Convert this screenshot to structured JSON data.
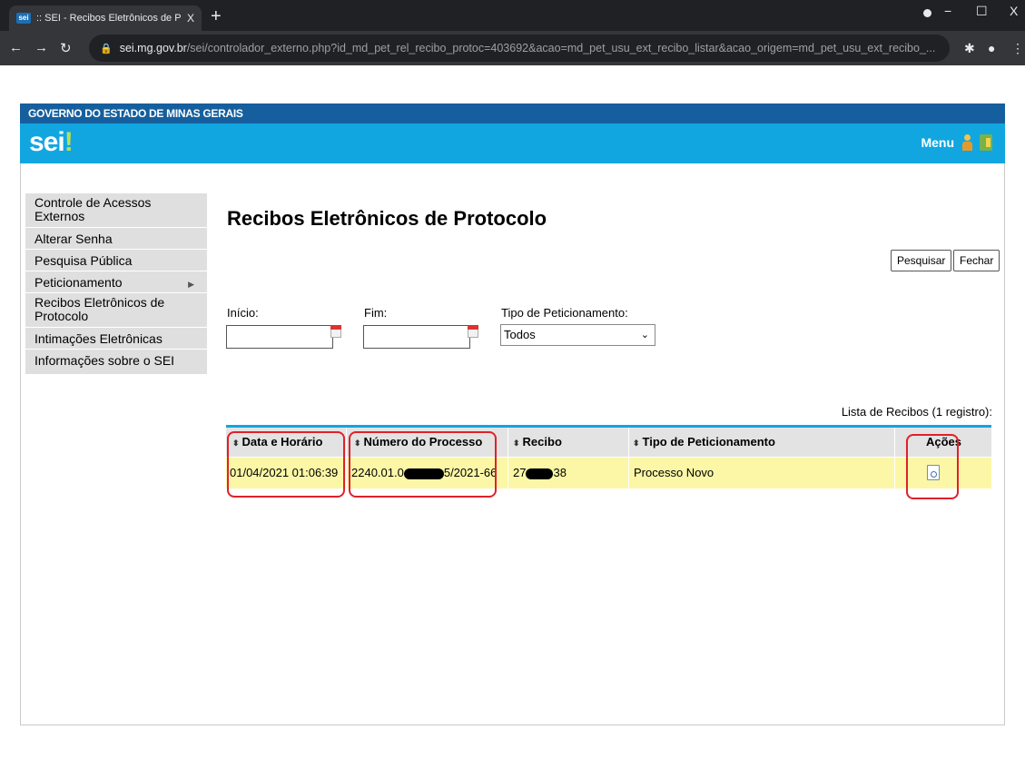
{
  "browser": {
    "favicon": "sei",
    "tab_title": ":: SEI - Recibos Eletrônicos de Pro",
    "tab_close": "X",
    "new_tab": "+",
    "window_min": "−",
    "window_max": "☐",
    "window_close": "X",
    "url_host": "sei.mg.gov.br",
    "url_path": "/sei/controlador_externo.php?id_md_pet_rel_recibo_protoc=403692&acao=md_pet_usu_ext_recibo_listar&acao_origem=md_pet_usu_ext_recibo_..."
  },
  "header": {
    "gov_title": "GOVERNO DO ESTADO DE MINAS GERAIS",
    "logo": "sei",
    "logo_bang": "!",
    "menu_label": "Menu"
  },
  "sidebar": {
    "items": [
      {
        "label": "Controle de Acessos Externos"
      },
      {
        "label": "Alterar Senha"
      },
      {
        "label": "Pesquisa Pública"
      },
      {
        "label": "Peticionamento",
        "arrow": "▶"
      },
      {
        "label": "Recibos Eletrônicos de Protocolo"
      },
      {
        "label": "Intimações Eletrônicas"
      },
      {
        "label": "Informações sobre o SEI"
      }
    ]
  },
  "main": {
    "title": "Recibos Eletrônicos de Protocolo",
    "btn_pesquisar": "Pesquisar",
    "btn_fechar": "Fechar",
    "label_inicio": "Início:",
    "label_fim": "Fim:",
    "label_tipo": "Tipo de Peticionamento:",
    "inicio_value": "",
    "fim_value": "",
    "tipo_selected": "Todos",
    "select_caret": "⌄",
    "caption": "Lista de Recibos (1 registro):",
    "table": {
      "headers": [
        "Data e Horário",
        "Número do Processo",
        "Recibo",
        "Tipo de Peticionamento",
        "Ações"
      ],
      "sort_icon": "⬍",
      "row": {
        "data": "01/04/2021 01:06:39",
        "processo_prefix": "2240.01.0",
        "processo_suffix": "5/2021-66",
        "recibo_prefix": "27",
        "recibo_suffix": "38",
        "tipo": "Processo Novo"
      }
    }
  },
  "colors": {
    "gov_bar": "#155f9e",
    "sei_bar": "#11a6e0",
    "row_highlight": "#fbf7a6",
    "annotation_red": "#e0202a"
  }
}
